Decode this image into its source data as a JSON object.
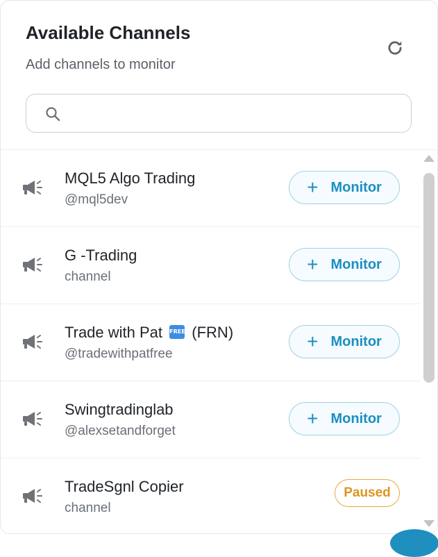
{
  "header": {
    "title": "Available Channels",
    "subtitle": "Add channels to monitor",
    "refresh_icon": "refresh-icon"
  },
  "search": {
    "value": "",
    "icon": "search-icon"
  },
  "channels": [
    {
      "name": "MQL5 Algo Trading",
      "handle": "@mql5dev",
      "action": "Monitor",
      "icon": "megaphone-icon"
    },
    {
      "name": "G -Trading",
      "handle": "channel",
      "action": "Monitor",
      "icon": "megaphone-icon"
    },
    {
      "name_before": "Trade with Pat",
      "badge": "FREE",
      "name_after": "(FRN)",
      "handle": "@tradewithpatfree",
      "action": "Monitor",
      "icon": "megaphone-icon"
    },
    {
      "name": "Swingtradinglab",
      "handle": "@alexsetandforget",
      "action": "Monitor",
      "icon": "megaphone-icon"
    },
    {
      "name": "TradeSgnl Copier",
      "handle": "channel",
      "status": "Paused",
      "icon": "megaphone-icon"
    }
  ],
  "colors": {
    "accent": "#1a8fc2",
    "paused": "#dd9420"
  }
}
